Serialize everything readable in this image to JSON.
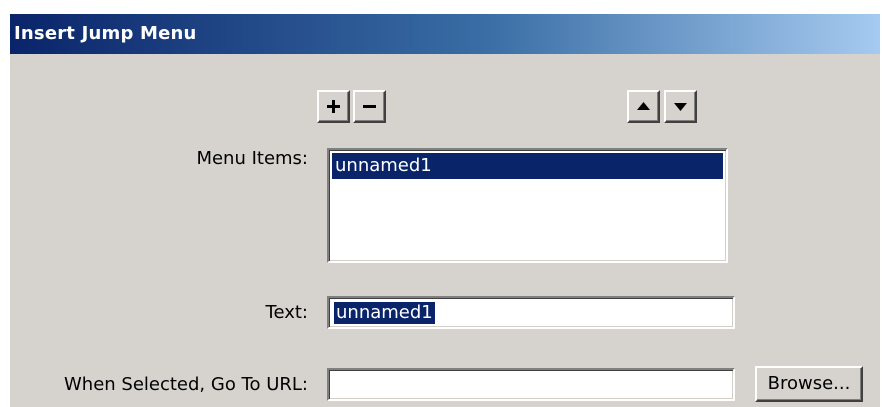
{
  "window": {
    "title": "Insert Jump Menu"
  },
  "toolbar": {
    "add_icon": "plus-icon",
    "remove_icon": "minus-icon",
    "move_up_icon": "arrow-up-icon",
    "move_down_icon": "arrow-down-icon"
  },
  "menu_items": {
    "label": "Menu Items:",
    "items": [
      {
        "label": "unnamed1",
        "selected": true
      }
    ]
  },
  "text_field": {
    "label": "Text:",
    "value": "unnamed1"
  },
  "url_field": {
    "label": "When Selected, Go To URL:",
    "value": "",
    "browse_label": "Browse..."
  },
  "colors": {
    "title_gradient_start": "#0a246a",
    "title_gradient_end": "#a6caf0",
    "dialog_background": "#d6d3ce",
    "selection_background": "#0a246a",
    "selection_text": "#ffffff"
  }
}
